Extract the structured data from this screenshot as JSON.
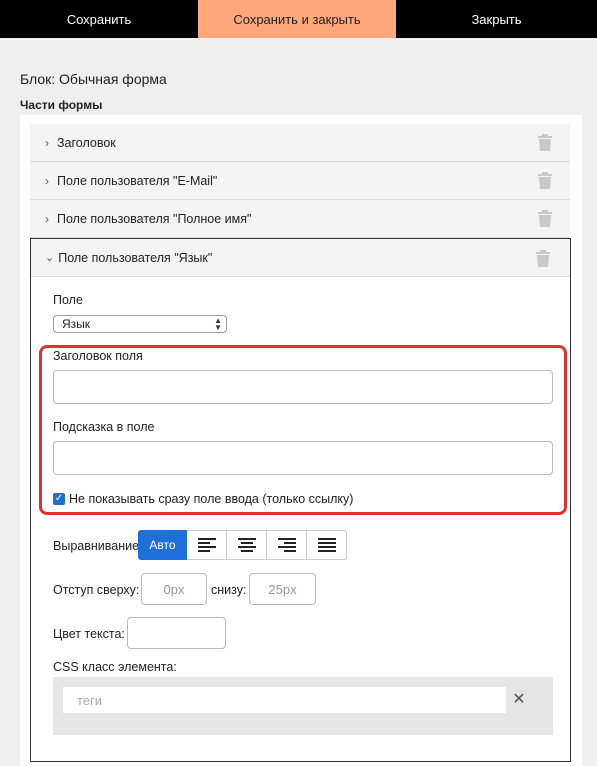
{
  "toolbar": {
    "save": "Сохранить",
    "save_close": "Сохранить и закрыть",
    "close": "Закрыть"
  },
  "block_title": "Блок: Обычная форма",
  "parts_title": "Части формы",
  "parts": [
    {
      "label": "Заголовок"
    },
    {
      "label": "Поле пользователя \"E-Mail\""
    },
    {
      "label": "Поле пользователя \"Полное имя\""
    },
    {
      "label": "Поле пользователя \"Язык\""
    }
  ],
  "form": {
    "field_label": "Поле",
    "field_select_value": "Язык",
    "title_label": "Заголовок поля",
    "title_value": "",
    "hint_label": "Подсказка в поле",
    "hint_value": "",
    "checkbox_label": "Не показывать сразу поле ввода (только ссылку)",
    "checkbox_checked": true,
    "align_label": "Выравнивание",
    "align_auto": "Авто",
    "align_options": [
      "left",
      "center",
      "right",
      "justify"
    ],
    "margin_top_label": "Отступ сверху:",
    "margin_top_placeholder": "0px",
    "margin_bottom_label": "снизу:",
    "margin_bottom_placeholder": "25px",
    "text_color_label": "Цвет текста:",
    "css_class_label": "CSS класс элемента:",
    "tags_placeholder": "теги"
  },
  "colors": {
    "toolbar_bg": "#000000",
    "save_close_bg": "#fda77a",
    "accent_blue": "#1e6fd9",
    "highlight_red": "#e0322d"
  }
}
